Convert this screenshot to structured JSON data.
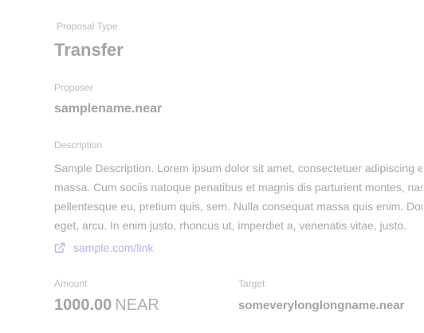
{
  "proposal_type": {
    "label": "Proposal Type",
    "value": "Transfer"
  },
  "proposer": {
    "label": "Proposer",
    "value": "samplename.near"
  },
  "description": {
    "label": "Description",
    "lines": [
      "Sample Description. Lorem ipsum dolor sit amet, consectetuer adipiscing elit. Aenean commodo ligula eget dolor. Aenean",
      "massa. Cum sociis natoque penatibus et magnis dis parturient montes, nascetur ridiculus mus. Donec quam felis, ultricies nec,",
      "pellentesque eu, pretium quis, sem. Nulla consequat massa quis enim. Donec pede justo, fringilla vel, aliquet nec, vulputate",
      "eget, arcu. In enim justo, rhoncus ut, imperdiet a, venenatis vitae, justo."
    ],
    "link": {
      "text": "sample.com/link",
      "icon": "external-link-icon"
    }
  },
  "amount": {
    "label": "Amount",
    "value": "1000.00",
    "unit": "NEAR"
  },
  "target": {
    "label": "Target",
    "value": "someverylonglongname.near"
  },
  "colors": {
    "link": "#bcb0e6",
    "label": "#bdbdbd",
    "value": "#a3a3a3"
  }
}
